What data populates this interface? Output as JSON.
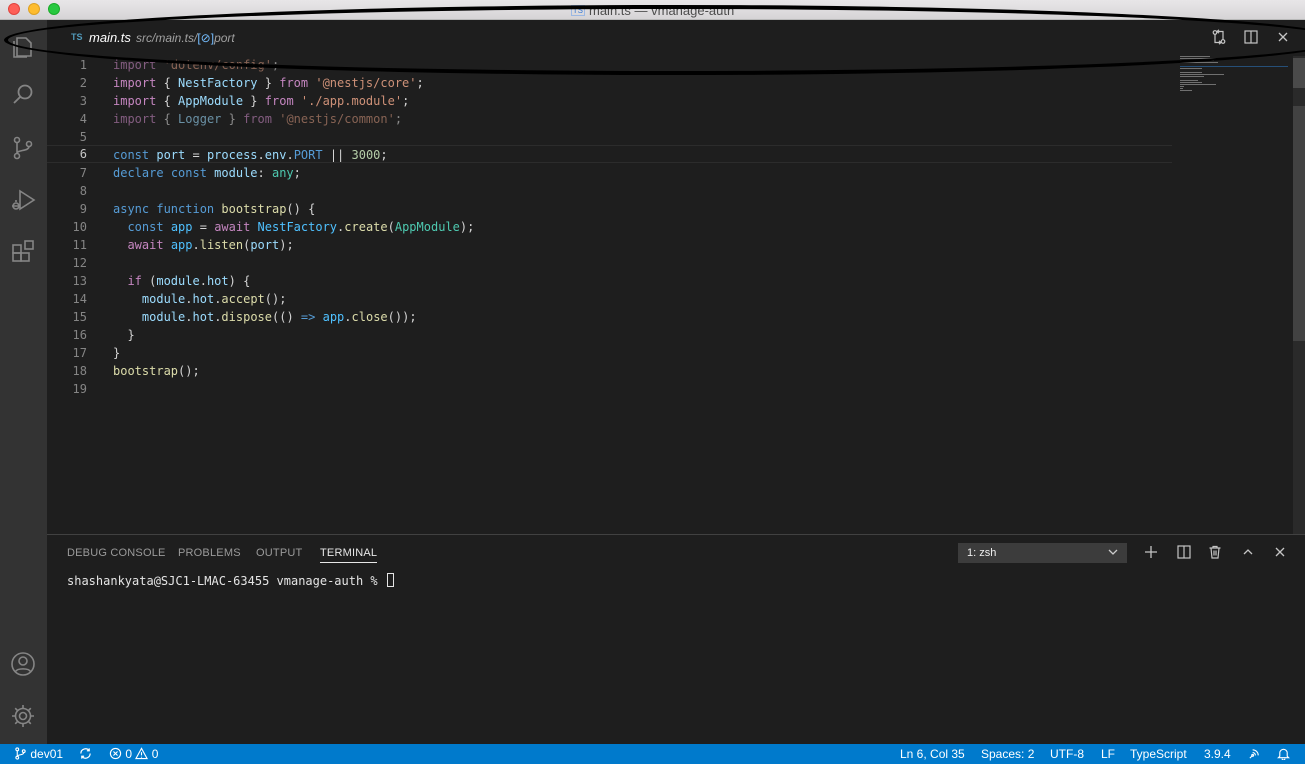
{
  "window": {
    "title": "main.ts — vmanage-auth",
    "title_badge": "TS"
  },
  "activity_bar": {
    "items": [
      "explorer-icon",
      "search-icon",
      "source-control-icon",
      "run-debug-icon",
      "extensions-icon",
      "accounts-icon",
      "manage-gear-icon"
    ]
  },
  "tab": {
    "lang_badge": "TS",
    "file_name": "main.ts",
    "breadcrumb": "src/main.ts/",
    "symbol_icon": "[⊘]",
    "symbol": "port"
  },
  "editor": {
    "current_line": 6,
    "lines": [
      {
        "n": "1"
      },
      {
        "n": "2"
      },
      {
        "n": "3"
      },
      {
        "n": "4"
      },
      {
        "n": "5"
      },
      {
        "n": "6"
      },
      {
        "n": "7"
      },
      {
        "n": "8"
      },
      {
        "n": "9"
      },
      {
        "n": "10"
      },
      {
        "n": "11"
      },
      {
        "n": "12"
      },
      {
        "n": "13"
      },
      {
        "n": "14"
      },
      {
        "n": "15"
      },
      {
        "n": "16"
      },
      {
        "n": "17"
      },
      {
        "n": "18"
      },
      {
        "n": "19"
      }
    ],
    "code": {
      "l1": {
        "kw": "import",
        "str": "'dotenv/config'",
        "end": ";"
      },
      "l2": {
        "kw": "import",
        "open": " { ",
        "name": "NestFactory",
        "close": " } ",
        "from": "from",
        "str": "'@nestjs/core'",
        "end": ";"
      },
      "l3": {
        "kw": "import",
        "open": " { ",
        "name": "AppModule",
        "close": " } ",
        "from": "from",
        "str": "'./app.module'",
        "end": ";"
      },
      "l4": {
        "kw": "import",
        "open": " { ",
        "name": "Logger",
        "close": " } ",
        "from": "from",
        "str": "'@nestjs/common'",
        "end": ";"
      },
      "l6": {
        "const": "const",
        "var": "port",
        "eq": " = ",
        "obj": "process",
        "dot1": ".",
        "env": "env",
        "dot2": ".",
        "port": "PORT",
        "or": " || ",
        "num": "3000",
        "end": ";"
      },
      "l7": {
        "declare": "declare",
        "const": "const",
        "var": "module",
        "colon": ": ",
        "type": "any",
        "end": ";"
      },
      "l9": {
        "async": "async",
        "function": "function",
        "name": "bootstrap",
        "rest": "() {"
      },
      "l10": {
        "indent": "  ",
        "const": "const",
        "var": "app",
        "eq": " = ",
        "await": "await",
        "cls": "NestFactory",
        "dot": ".",
        "fn": "create",
        "open": "(",
        "arg": "AppModule",
        "close": ");"
      },
      "l11": {
        "indent": "  ",
        "await": "await",
        "obj": "app",
        "dot": ".",
        "fn": "listen",
        "open": "(",
        "arg": "port",
        "close": ");"
      },
      "l13": {
        "indent": "  ",
        "if": "if",
        "open": " (",
        "obj": "module",
        "dot": ".",
        "prop": "hot",
        "close": ") {"
      },
      "l14": {
        "indent": "    ",
        "obj": "module",
        "dot1": ".",
        "prop": "hot",
        "dot2": ".",
        "fn": "accept",
        "rest": "();"
      },
      "l15": {
        "indent": "    ",
        "obj": "module",
        "dot1": ".",
        "prop": "hot",
        "dot2": ".",
        "fn": "dispose",
        "open": "(() ",
        "arrow": "=>",
        "sp": " ",
        "obj2": "app",
        "dot3": ".",
        "fn2": "close",
        "close": "());"
      },
      "l16": {
        "text": "  }"
      },
      "l17": {
        "text": "}"
      },
      "l18": {
        "fn": "bootstrap",
        "rest": "();"
      }
    }
  },
  "panel": {
    "tabs": [
      {
        "label": "DEBUG CONSOLE"
      },
      {
        "label": "PROBLEMS"
      },
      {
        "label": "OUTPUT"
      },
      {
        "label": "TERMINAL"
      }
    ],
    "active_tab": "TERMINAL",
    "terminal_select": "1: zsh",
    "terminal_prompt": "shashankyata@SJC1-LMAC-63455 vmanage-auth % "
  },
  "status_bar": {
    "branch": "dev01",
    "errors": "0",
    "warnings": "0",
    "position": "Ln 6, Col 35",
    "spaces": "Spaces: 2",
    "encoding": "UTF-8",
    "eol": "LF",
    "language": "TypeScript",
    "ts_version": "3.9.4"
  },
  "colors": {
    "status_bar": "#007acc",
    "activity_bar": "#333333",
    "editor_bg": "#1e1e1e",
    "annotation": "#000000"
  }
}
